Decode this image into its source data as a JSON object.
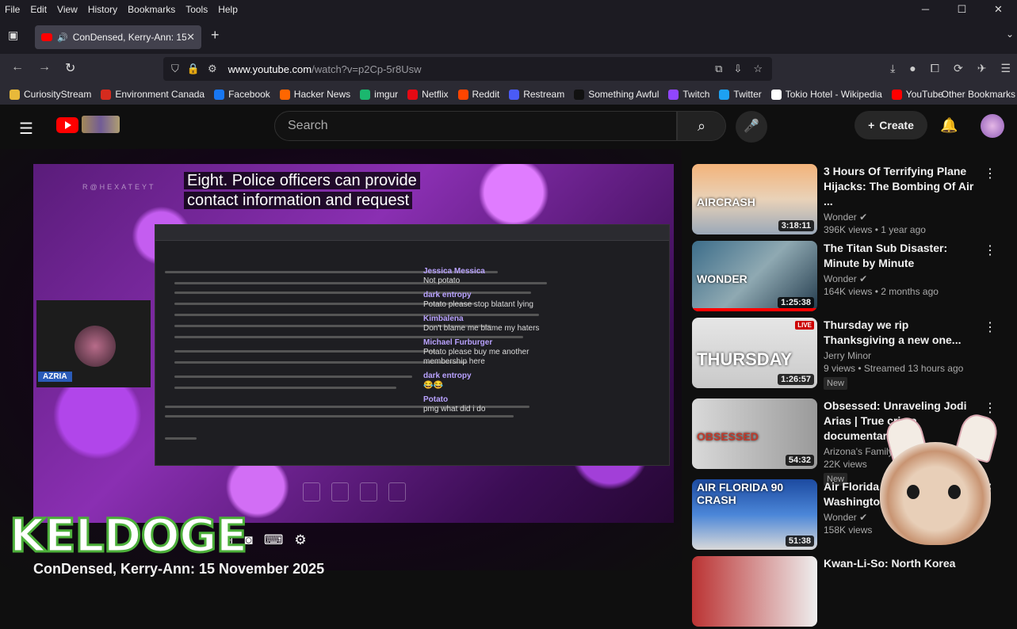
{
  "menu": {
    "file": "File",
    "edit": "Edit",
    "view": "View",
    "history": "History",
    "bookmarks": "Bookmarks",
    "tools": "Tools",
    "help": "Help"
  },
  "tab": {
    "title": "ConDensed, Kerry-Ann: 15"
  },
  "url": {
    "domain": "www.youtube.com",
    "path": "/watch?v=p2Cp-5r8Usw"
  },
  "bookmarks": [
    {
      "label": "CuriosityStream",
      "color": "#e8b93a"
    },
    {
      "label": "Environment Canada",
      "color": "#d52b1e"
    },
    {
      "label": "Facebook",
      "color": "#1877f2"
    },
    {
      "label": "Hacker News",
      "color": "#ff6600"
    },
    {
      "label": "imgur",
      "color": "#1bb76e"
    },
    {
      "label": "Netflix",
      "color": "#e50914"
    },
    {
      "label": "Reddit",
      "color": "#ff4500"
    },
    {
      "label": "Restream",
      "color": "#4a5bf6"
    },
    {
      "label": "Something Awful",
      "color": "#111111"
    },
    {
      "label": "Twitch",
      "color": "#9146ff"
    },
    {
      "label": "Twitter",
      "color": "#1da1f2"
    },
    {
      "label": "Tokio Hotel - Wikipedia",
      "color": "#ffffff"
    },
    {
      "label": "YouTube",
      "color": "#ff0000"
    }
  ],
  "other_bookmarks": "Other Bookmarks",
  "yt": {
    "search_placeholder": "Search",
    "create": "Create"
  },
  "video": {
    "caption_line1": "Eight. Police officers can provide",
    "caption_line2": "contact information and request",
    "webcam_label": "AZRIA",
    "watermark": "R@HEXATEYT",
    "overlay_text": "KELDOGE",
    "title": "ConDensed, Kerry-Ann: 15 November 2025",
    "chat": [
      {
        "name": "Jessica Messica",
        "msg": "Not potato"
      },
      {
        "name": "dark entropy",
        "msg": "Potato please stop blatant lying"
      },
      {
        "name": "Kimbalena",
        "msg": "Don't blame me blame my haters"
      },
      {
        "name": "Michael Furburger",
        "msg": "Potato please buy me another membership here"
      },
      {
        "name": "dark entropy",
        "msg": "😂😂"
      },
      {
        "name": "Potato",
        "msg": "pmg what did i do"
      }
    ]
  },
  "recommendations": [
    {
      "title": "3 Hours Of Terrifying Plane Hijacks: The Bombing Of Air ...",
      "channel": "Wonder",
      "meta": "396K views • 1 year ago",
      "duration": "3:18:11",
      "thumb_text": "AIRCRASH",
      "badge": ""
    },
    {
      "title": "The Titan Sub Disaster: Minute by Minute",
      "channel": "Wonder",
      "meta": "164K views • 2 months ago",
      "duration": "1:25:38",
      "thumb_text": "WONDER",
      "badge": ""
    },
    {
      "title": "Thursday we rip Thanksgiving a new one...",
      "channel": "Jerry Minor",
      "meta": "9 views • Streamed 13 hours ago",
      "duration": "1:26:57",
      "thumb_text": "THURSDAY",
      "badge": "New"
    },
    {
      "title": "Obsessed: Unraveling Jodi Arias | True crime documentary",
      "channel": "Arizona's Family",
      "meta": "22K views",
      "duration": "54:32",
      "thumb_text": "OBSESSED",
      "badge": "New"
    },
    {
      "title": "Air Florida 90 Crash Into Washington",
      "channel": "Wonder",
      "meta": "158K views",
      "duration": "51:38",
      "thumb_text": "AIR FLORIDA 90 CRASH",
      "badge": ""
    },
    {
      "title": "Kwan-Li-So: North Korea",
      "channel": "",
      "meta": "",
      "duration": "",
      "thumb_text": "",
      "badge": ""
    }
  ]
}
